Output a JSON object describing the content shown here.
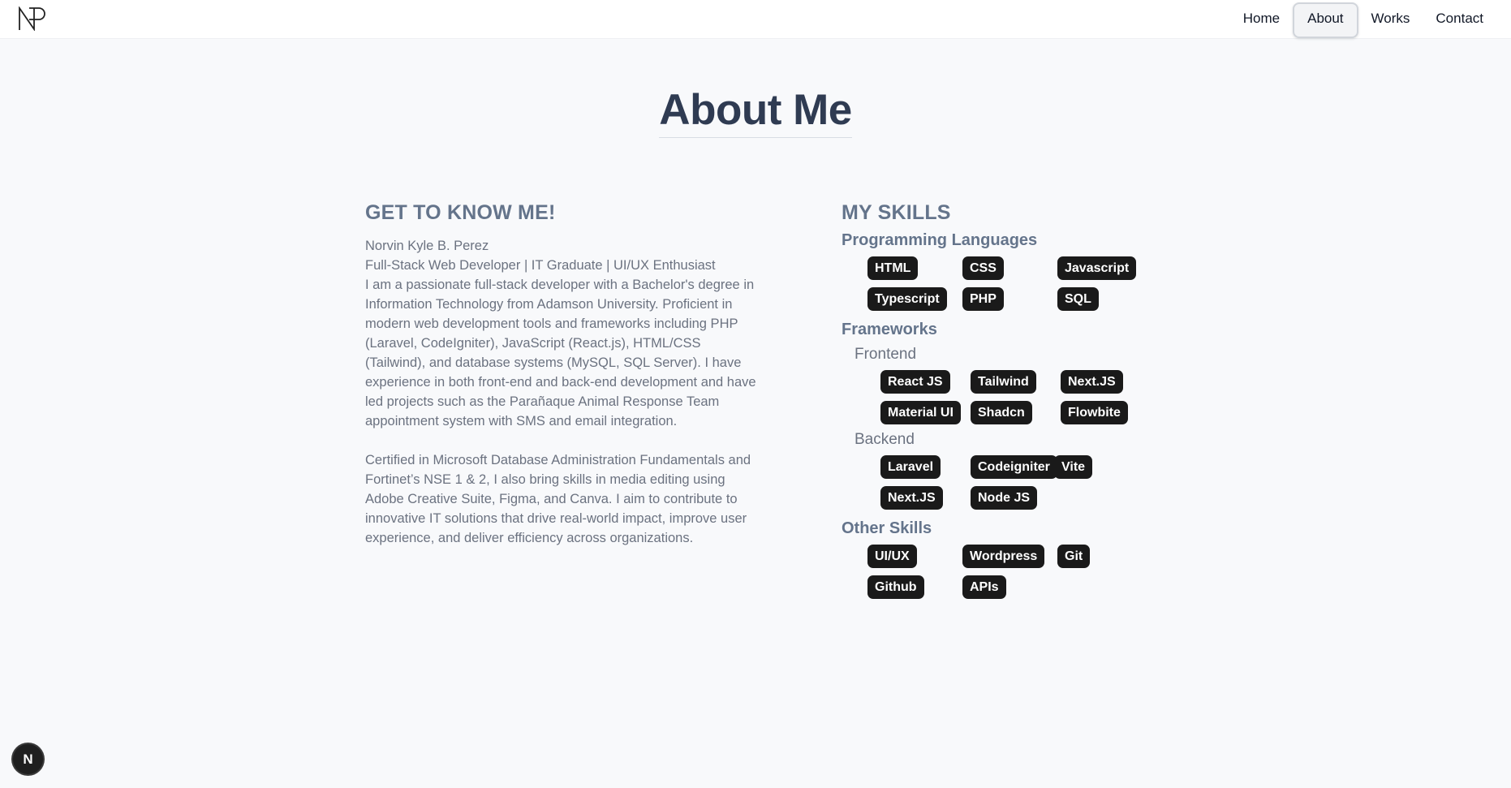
{
  "nav": {
    "logo_icon": "np-logo-icon",
    "links": [
      "Home",
      "About",
      "Works",
      "Contact"
    ],
    "active": "About"
  },
  "page": {
    "title": "About Me"
  },
  "about": {
    "heading": "GET TO KNOW ME!",
    "name": "Norvin Kyle B. Perez",
    "tagline": "Full-Stack Web Developer | IT Graduate | UI/UX Enthusiast",
    "para1": "I am a passionate full-stack developer with a Bachelor's degree in Information Technology from Adamson University. Proficient in modern web development tools and frameworks including PHP (Laravel, CodeIgniter), JavaScript (React.js), HTML/CSS (Tailwind), and database systems (MySQL, SQL Server). I have experience in both front-end and back-end development and have led projects such as the Parañaque Animal Response Team appointment system with SMS and email integration.",
    "para2": "Certified in Microsoft Database Administration Fundamentals and Fortinet’s NSE 1 & 2, I also bring skills in media editing using Adobe Creative Suite, Figma, and Canva. I aim to contribute to innovative IT solutions that drive real-world impact, improve user experience, and deliver efficiency across organizations."
  },
  "skills": {
    "heading": "MY SKILLS",
    "programming": {
      "label": "Programming Languages",
      "items": [
        "HTML",
        "CSS",
        "Javascript",
        "Typescript",
        "PHP",
        "SQL"
      ]
    },
    "frameworks": {
      "label": "Frameworks",
      "frontend": {
        "label": "Frontend",
        "items": [
          "React JS",
          "Tailwind",
          "Next.JS",
          "Material UI",
          "Shadcn",
          "Flowbite"
        ]
      },
      "backend": {
        "label": "Backend",
        "items": [
          "Laravel",
          "Codeigniter",
          "Vite",
          "Next.JS",
          "Node JS"
        ]
      }
    },
    "other": {
      "label": "Other Skills",
      "items": [
        "UI/UX",
        "Wordpress",
        "Git",
        "Github",
        "APIs"
      ]
    }
  },
  "fab": {
    "label": "N"
  },
  "colors": {
    "chip_bg": "#1a1a1a",
    "title": "#2f3b52",
    "muted": "#64748b",
    "page_bg": "#f8f9fb"
  }
}
